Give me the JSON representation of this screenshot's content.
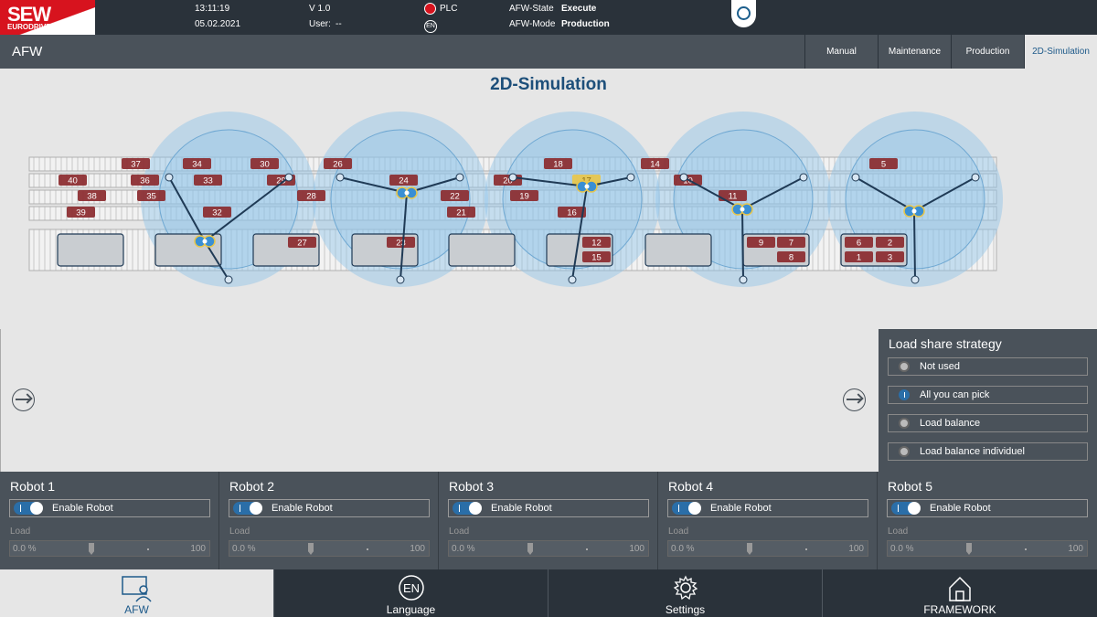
{
  "header": {
    "logo_main": "SEW",
    "logo_sub": "EURODRIVE",
    "time": "13:11:19",
    "date": "05.02.2021",
    "version": "V 1.0",
    "user_label": "User:",
    "user_value": "--",
    "plc_label": "PLC",
    "lang_badge": "EN",
    "afw_state_label": "AFW-State",
    "afw_state_value": "Execute",
    "afw_mode_label": "AFW-Mode",
    "afw_mode_value": "Production"
  },
  "titlebar": {
    "app": "AFW",
    "tabs": [
      {
        "label": "Manual",
        "active": false
      },
      {
        "label": "Maintenance",
        "active": false
      },
      {
        "label": "Production",
        "active": false
      },
      {
        "label": "2D-Simulation",
        "active": true
      }
    ]
  },
  "simulation": {
    "title": "2D-Simulation",
    "items": [
      "37",
      "34",
      "30",
      "26",
      "18",
      "14",
      "5",
      "40",
      "36",
      "33",
      "29",
      "24",
      "20",
      "17",
      "10",
      "38",
      "35",
      "28",
      "22",
      "19",
      "11",
      "39",
      "32",
      "21",
      "16",
      "27",
      "23",
      "12",
      "15",
      "9",
      "7",
      "8",
      "6",
      "2",
      "1",
      "3"
    ]
  },
  "load_share": {
    "title": "Load share strategy",
    "options": [
      {
        "label": "Not used",
        "selected": false
      },
      {
        "label": "All you can pick",
        "selected": true
      },
      {
        "label": "Load balance",
        "selected": false
      },
      {
        "label": "Load balance individuel",
        "selected": false
      }
    ]
  },
  "robots": [
    {
      "name": "Robot 1",
      "enable_label": "Enable Robot",
      "load_label": "Load",
      "load_value": "0.0 %",
      "load_max": "100"
    },
    {
      "name": "Robot 2",
      "enable_label": "Enable Robot",
      "load_label": "Load",
      "load_value": "0.0 %",
      "load_max": "100"
    },
    {
      "name": "Robot 3",
      "enable_label": "Enable Robot",
      "load_label": "Load",
      "load_value": "0.0 %",
      "load_max": "100"
    },
    {
      "name": "Robot 4",
      "enable_label": "Enable Robot",
      "load_label": "Load",
      "load_value": "0.0 %",
      "load_max": "100"
    },
    {
      "name": "Robot 5",
      "enable_label": "Enable Robot",
      "load_label": "Load",
      "load_value": "0.0 %",
      "load_max": "100"
    }
  ],
  "nav": [
    {
      "label": "AFW",
      "icon": "monitor-user-icon",
      "active": true
    },
    {
      "label": "Language",
      "icon": "language-en-icon",
      "active": false
    },
    {
      "label": "Settings",
      "icon": "gear-icon",
      "active": false
    },
    {
      "label": "FRAMEWORK",
      "icon": "home-icon",
      "active": false
    }
  ],
  "colors": {
    "dark": "#2a323a",
    "panel": "#4a525a",
    "accent": "#1d4f7a",
    "brand_red": "#d7131e",
    "item": "#8b2a2e"
  }
}
